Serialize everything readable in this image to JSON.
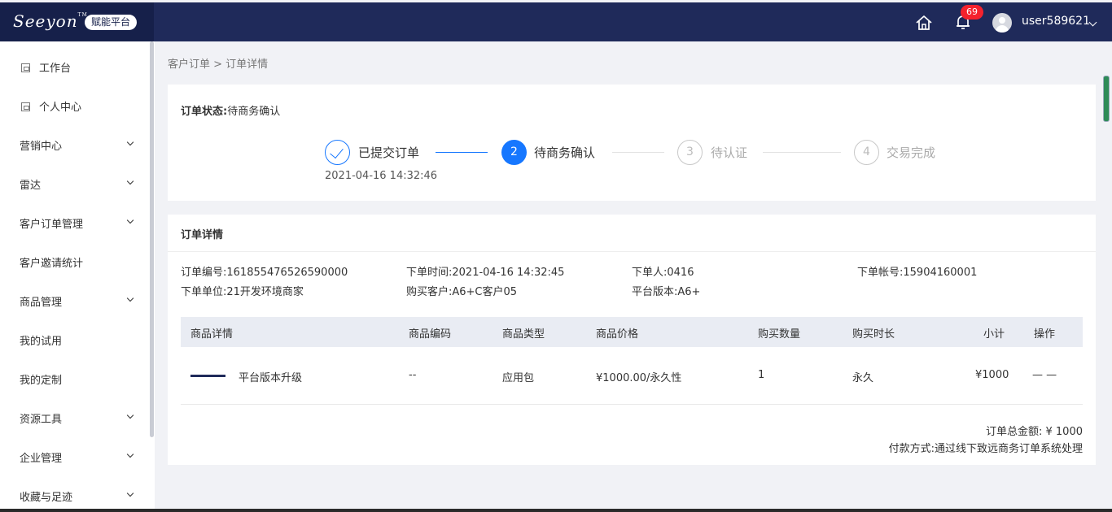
{
  "header": {
    "logo_text": "Seeyon",
    "logo_tm": "TM",
    "platform_tag": "赋能平台",
    "notification_count": "69",
    "username": "user589621"
  },
  "sidebar": {
    "items": [
      {
        "label": "工作台",
        "icon": "page-icon",
        "expandable": false
      },
      {
        "label": "个人中心",
        "icon": "page-icon",
        "expandable": false
      },
      {
        "label": "营销中心",
        "expandable": true
      },
      {
        "label": "雷达",
        "expandable": true
      },
      {
        "label": "客户订单管理",
        "expandable": true
      },
      {
        "label": "客户邀请统计",
        "expandable": false
      },
      {
        "label": "商品管理",
        "expandable": true
      },
      {
        "label": "我的试用",
        "expandable": false
      },
      {
        "label": "我的定制",
        "expandable": false
      },
      {
        "label": "资源工具",
        "expandable": true
      },
      {
        "label": "企业管理",
        "expandable": true
      },
      {
        "label": "收藏与足迹",
        "expandable": true
      }
    ]
  },
  "breadcrumb": "客户订单 > 订单详情",
  "order_status": {
    "label": "订单状态:",
    "value": "待商务确认"
  },
  "steps": [
    {
      "index": "1",
      "title": "已提交订单",
      "state": "done",
      "time": "2021-04-16 14:32:46"
    },
    {
      "index": "2",
      "title": "待商务确认",
      "state": "active"
    },
    {
      "index": "3",
      "title": "待认证",
      "state": "wait"
    },
    {
      "index": "4",
      "title": "交易完成",
      "state": "wait"
    }
  ],
  "order_detail": {
    "title": "订单详情",
    "order_no": "订单编号:161855476526590000",
    "order_time": "下单时间:2021-04-16 14:32:45",
    "orderer": "下单人:0416",
    "account": "下单帐号:15904160001",
    "unit": "下单单位:21开发环境商家",
    "customer": "购买客户:A6+C客户05",
    "version": "平台版本:A6+"
  },
  "table": {
    "headers": [
      "商品详情",
      "商品编码",
      "商品类型",
      "商品价格",
      "购买数量",
      "购买时长",
      "小计",
      "操作"
    ],
    "rows": [
      {
        "name": "平台版本升级",
        "code": "--",
        "type": "应用包",
        "price": "¥1000.00/永久性",
        "qty": "1",
        "duration": "永久",
        "subtotal": "¥1000",
        "action": "— —"
      }
    ]
  },
  "summary": {
    "total": "订单总金额: ¥ 1000",
    "payment": "付款方式:通过线下致远商务订单系统处理"
  },
  "colors": {
    "header_bg": "#1f2a5a",
    "accent": "#1677ff",
    "badge": "#f5222d"
  }
}
